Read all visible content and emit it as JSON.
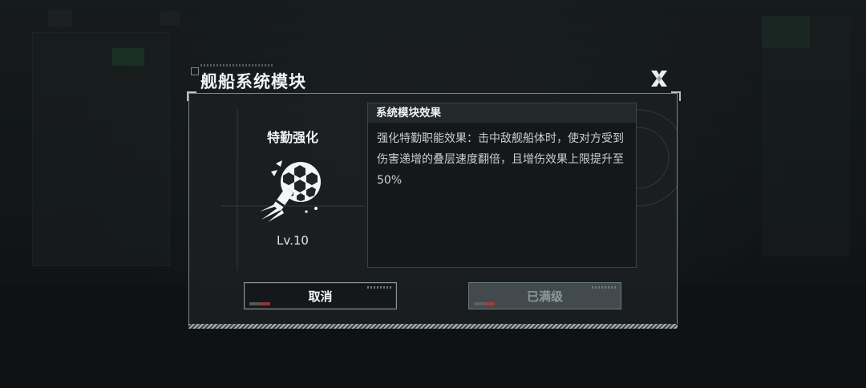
{
  "dialog": {
    "title": "舰船系统模块",
    "close_icon": "close-x-icon"
  },
  "module": {
    "name": "特勤强化",
    "icon": "missile-impact-icon",
    "level": "Lv.10"
  },
  "effect": {
    "header": "系统模块效果",
    "description": "强化特勤职能效果：击中敌舰船体时，使对方受到伤害递增的叠层速度翻倍，且增伤效果上限提升至50%"
  },
  "buttons": {
    "cancel_label": "取消",
    "maxed_label": "已满级"
  },
  "colors": {
    "frame": "#7d878b",
    "text_primary": "#f1f3f4",
    "text_body": "#c9cfd1",
    "disabled_button": "#434a4d"
  }
}
